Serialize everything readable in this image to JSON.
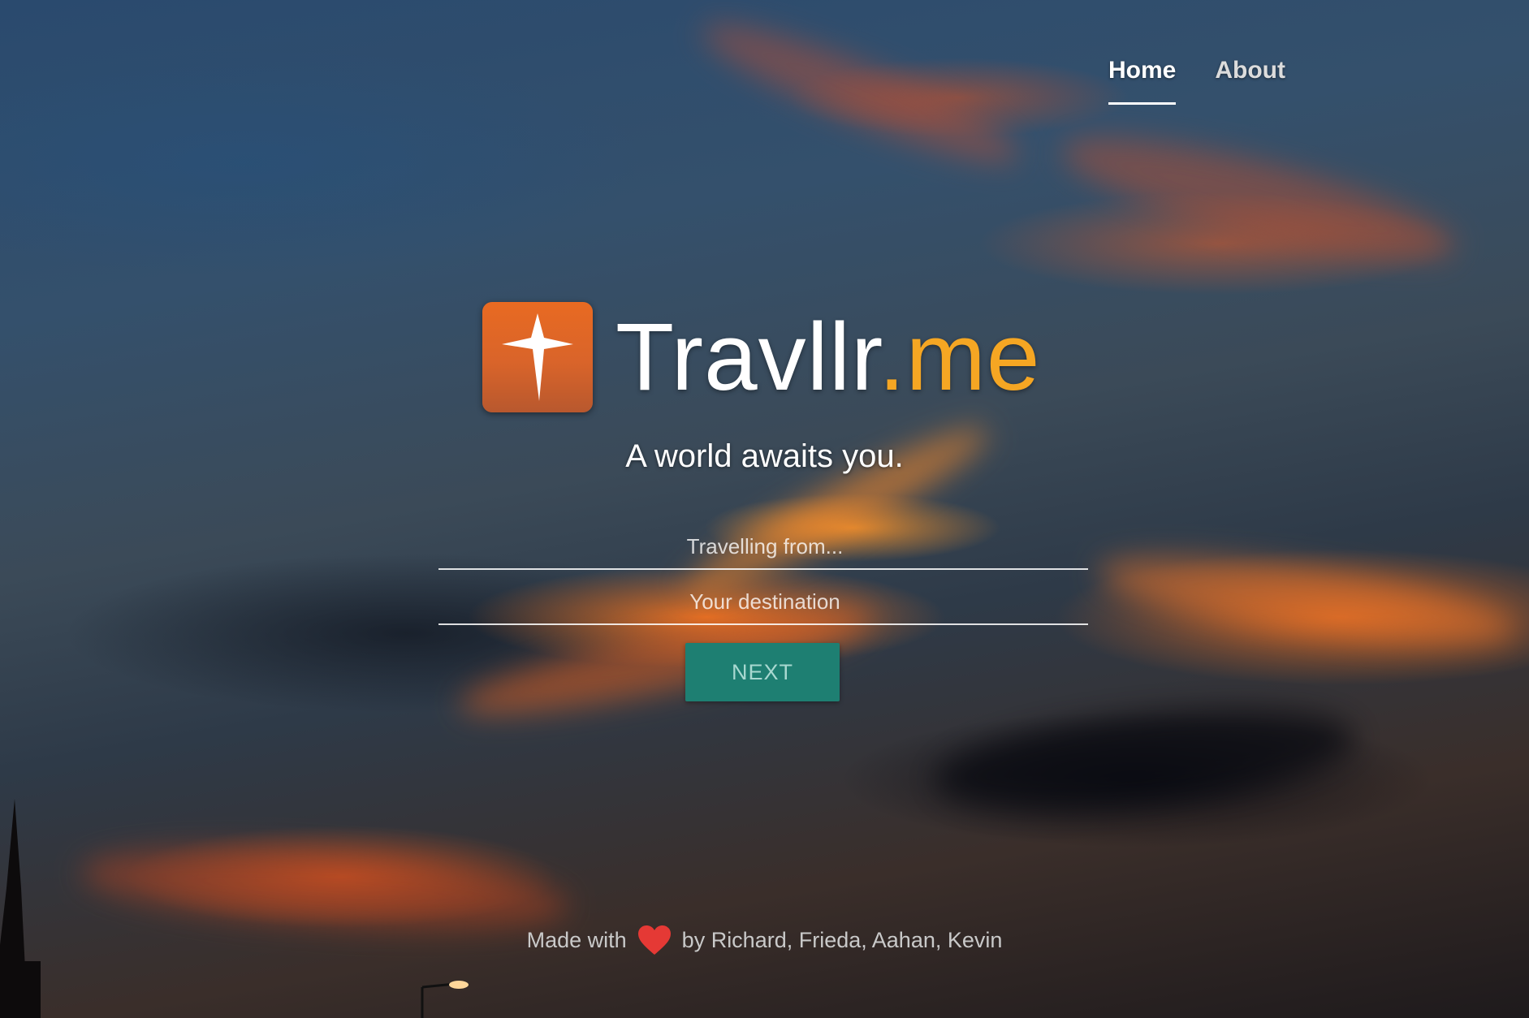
{
  "nav": {
    "items": [
      {
        "label": "Home",
        "active": true
      },
      {
        "label": "About",
        "active": false
      }
    ]
  },
  "logo": {
    "icon": "compass-star-icon",
    "brand_main": "Travllr",
    "brand_tld": ".me",
    "tld_color": "#f5a623"
  },
  "tagline": "A world awaits you.",
  "form": {
    "origin_placeholder": "Travelling from...",
    "destination_placeholder": "Your destination",
    "next_label": "NEXT",
    "button_color": "#1e7f72"
  },
  "footer": {
    "prefix": "Made with",
    "heart_icon": "heart-icon",
    "suffix": "by Richard, Frieda, Aahan, Kevin",
    "heart_color": "#e53935"
  }
}
